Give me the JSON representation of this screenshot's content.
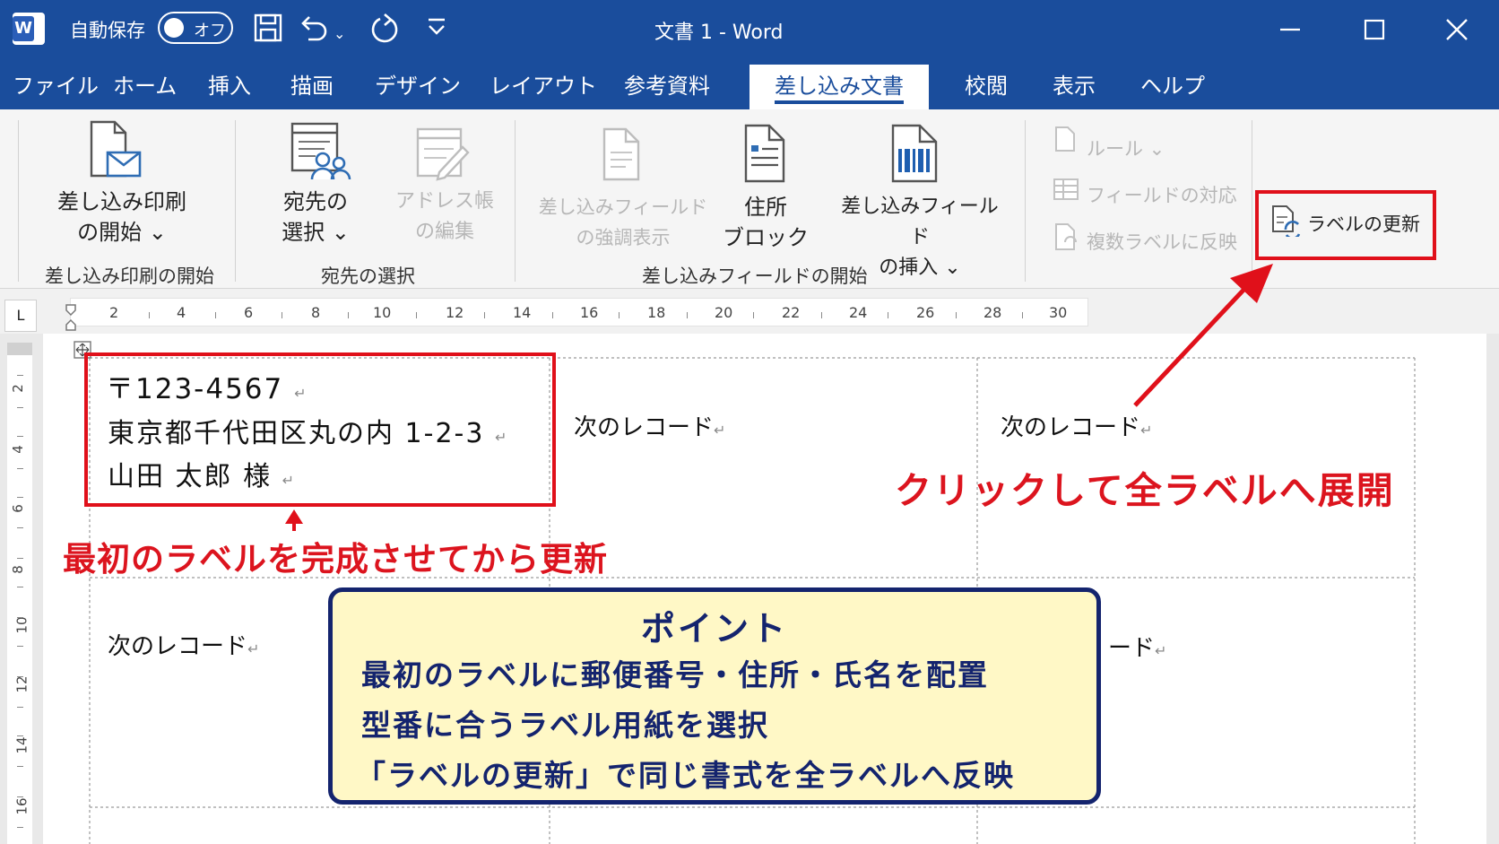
{
  "titlebar": {
    "app_icon": "word-icon",
    "app_letter": "W",
    "autosave_label": "自動保存",
    "autosave_state": "オフ",
    "document_title": "文書 1  -  Word"
  },
  "menu": {
    "tabs": [
      "ファイル",
      "ホーム",
      "挿入",
      "描画",
      "デザイン",
      "レイアウト",
      "参考資料",
      "差し込み文書",
      "校閲",
      "表示",
      "ヘルプ"
    ],
    "active_tab": "差し込み文書"
  },
  "ribbon": {
    "start_merge": {
      "line1": "差し込み印刷",
      "line2": "の開始 ⌄",
      "group": "差し込み印刷の開始"
    },
    "select_recipients": {
      "line1": "宛先の",
      "line2": "選択 ⌄",
      "group": "宛先の選択"
    },
    "edit_list": {
      "line1": "アドレス帳",
      "line2": "の編集"
    },
    "highlight_fields": {
      "line1": "差し込みフィールド",
      "line2": "の強調表示"
    },
    "address_block": {
      "line1": "住所",
      "line2": "ブロック"
    },
    "insert_field": {
      "line1": "差し込みフィールド",
      "line2": "の挿入 ⌄"
    },
    "fields_group": "差し込みフィールドの開始",
    "rules": "ルール ⌄",
    "match_fields": "フィールドの対応",
    "propagate": "複数ラベルに反映",
    "update_labels": "ラベルの更新"
  },
  "ruler": {
    "corner": "L",
    "numbers": [
      "2",
      "4",
      "6",
      "8",
      "10",
      "12",
      "14",
      "16",
      "18",
      "20",
      "22",
      "24",
      "26",
      "28",
      "30"
    ],
    "vertical_numbers": [
      "2",
      "4",
      "6",
      "8",
      "10",
      "12",
      "14",
      "16"
    ]
  },
  "document": {
    "first_label": {
      "postal": "〒123-4567",
      "address": "東京都千代田区丸の内 1-2-3",
      "name": "山田 太郎 様"
    },
    "next_record": "次のレコード",
    "next_record_partial": "ード",
    "paragraph_mark": "↵"
  },
  "annotations": {
    "first_label_note": "最初のラベルを完成させてから更新",
    "update_note": "クリックして全ラベルへ展開",
    "point_title": "ポイント",
    "point_lines": [
      "最初のラベルに郵便番号・住所・氏名を配置",
      "型番に合うラベル用紙を選択",
      "「ラベルの更新」で同じ書式を全ラベルへ反映"
    ]
  },
  "colors": {
    "titlebar": "#1a4d9c",
    "annotation_red": "#e0101a",
    "point_background": "#fff8c6",
    "point_border": "#14246e"
  }
}
